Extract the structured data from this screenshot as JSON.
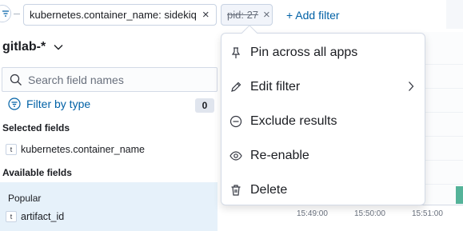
{
  "filter_bar": {
    "filters": [
      {
        "label": "kubernetes.container_name: sidekiq",
        "remove": "×"
      },
      {
        "label": "pid: 27",
        "remove": "×"
      }
    ],
    "add_filter": "+ Add filter"
  },
  "sidebar": {
    "index_pattern": "gitlab-*",
    "search": {
      "placeholder": "Search field names",
      "value": ""
    },
    "filter_by_type": "Filter by type",
    "filter_count": "0",
    "selected_fields_title": "Selected fields",
    "selected_fields": [
      {
        "type": "t",
        "name": "kubernetes.container_name"
      }
    ],
    "available_fields_title": "Available fields",
    "popular_label": "Popular",
    "popular_fields": [
      {
        "type": "t",
        "name": "artifact_id"
      }
    ]
  },
  "chart": {
    "ticks": [
      "15:49:00",
      "15:50:00",
      "15:51:00"
    ],
    "bar_color": "#54b399"
  },
  "context_menu": {
    "items": [
      {
        "label": "Pin across all apps",
        "icon": "pin-icon"
      },
      {
        "label": "Edit filter",
        "icon": "pencil-icon",
        "has_submenu": true
      },
      {
        "label": "Exclude results",
        "icon": "minus-circle-icon"
      },
      {
        "label": "Re-enable",
        "icon": "eye-icon"
      },
      {
        "label": "Delete",
        "icon": "trash-icon"
      }
    ]
  },
  "colors": {
    "accent": "#0061a6",
    "border": "#d3dae6",
    "text": "#1a1c21"
  }
}
